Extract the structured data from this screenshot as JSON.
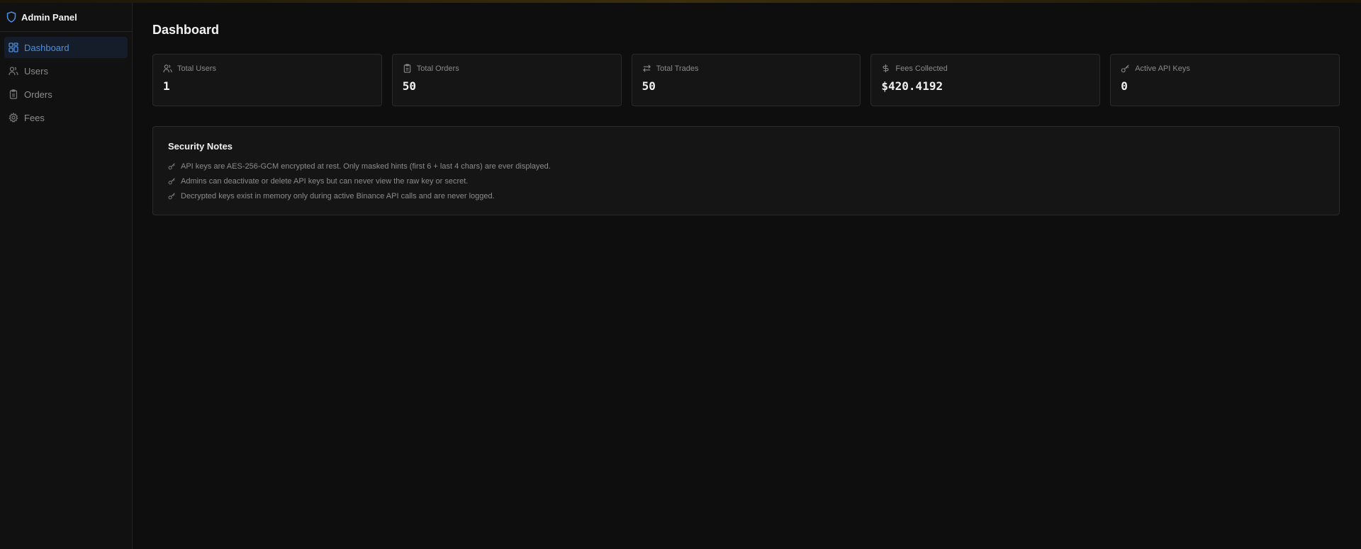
{
  "colors": {
    "accent": "#4d8fe0",
    "background": "#0e0e0e",
    "card_bg": "#151515",
    "card_border": "#2a2a2a",
    "muted_text": "#8c8c8c"
  },
  "sidebar": {
    "brand": {
      "title": "Admin Panel",
      "icon": "shield-icon"
    },
    "items": [
      {
        "label": "Dashboard",
        "icon": "dashboard-grid-icon",
        "active": true
      },
      {
        "label": "Users",
        "icon": "users-icon",
        "active": false
      },
      {
        "label": "Orders",
        "icon": "clipboard-icon",
        "active": false
      },
      {
        "label": "Fees",
        "icon": "gear-icon",
        "active": false
      }
    ]
  },
  "main": {
    "title": "Dashboard",
    "stats": [
      {
        "label": "Total Users",
        "value": "1",
        "icon": "users-icon"
      },
      {
        "label": "Total Orders",
        "value": "50",
        "icon": "clipboard-icon"
      },
      {
        "label": "Total Trades",
        "value": "50",
        "icon": "arrows-swap-icon"
      },
      {
        "label": "Fees Collected",
        "value": "$420.4192",
        "icon": "dollar-icon"
      },
      {
        "label": "Active API Keys",
        "value": "0",
        "icon": "key-icon"
      }
    ],
    "security": {
      "title": "Security Notes",
      "notes": [
        "API keys are AES-256-GCM encrypted at rest. Only masked hints (first 6 + last 4 chars) are ever displayed.",
        "Admins can deactivate or delete API keys but can never view the raw key or secret.",
        "Decrypted keys exist in memory only during active Binance API calls and are never logged."
      ]
    }
  }
}
